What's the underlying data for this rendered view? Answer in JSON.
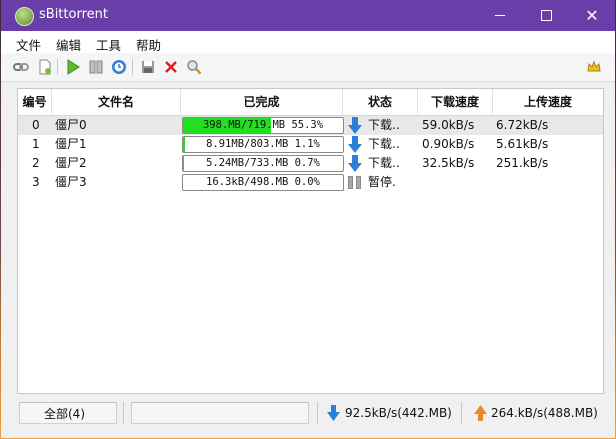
{
  "window": {
    "title": "sBittorrent"
  },
  "menu": {
    "items": [
      "文件",
      "编辑",
      "工具",
      "帮助"
    ]
  },
  "table": {
    "columns": [
      "编号",
      "文件名",
      "已完成",
      "状态",
      "下载速度",
      "上传速度"
    ],
    "rows": [
      {
        "id": "0",
        "name": "僵尸0",
        "progress_text": "398.MB/719.MB 55.3%",
        "progress": 0.553,
        "status": "下载..",
        "status_icon": "download-arrow-icon",
        "down": "59.0kB/s",
        "up": "6.72kB/s"
      },
      {
        "id": "1",
        "name": "僵尸1",
        "progress_text": "8.91MB/803.MB 1.1%",
        "progress": 0.011,
        "status": "下载..",
        "status_icon": "download-arrow-icon",
        "down": "0.90kB/s",
        "up": "5.61kB/s"
      },
      {
        "id": "2",
        "name": "僵尸2",
        "progress_text": "5.24MB/733.MB 0.7%",
        "progress": 0.007,
        "status": "下载..",
        "status_icon": "download-arrow-icon",
        "down": "32.5kB/s",
        "up": "251.kB/s"
      },
      {
        "id": "3",
        "name": "僵尸3",
        "progress_text": "16.3kB/498.MB 0.0%",
        "progress": 0.0,
        "status": "暂停.",
        "status_icon": "pause-icon",
        "down": "",
        "up": ""
      }
    ]
  },
  "statusbar": {
    "all_label": "全部(4)",
    "download_total": "92.5kB/s(442.MB)",
    "upload_total": "264.kB/s(488.MB)"
  },
  "colors": {
    "titlebar": "#6a3ea8",
    "progress_fill": "#21e021",
    "download_arrow": "#2d7fd8",
    "upload_arrow": "#e88a2a"
  }
}
